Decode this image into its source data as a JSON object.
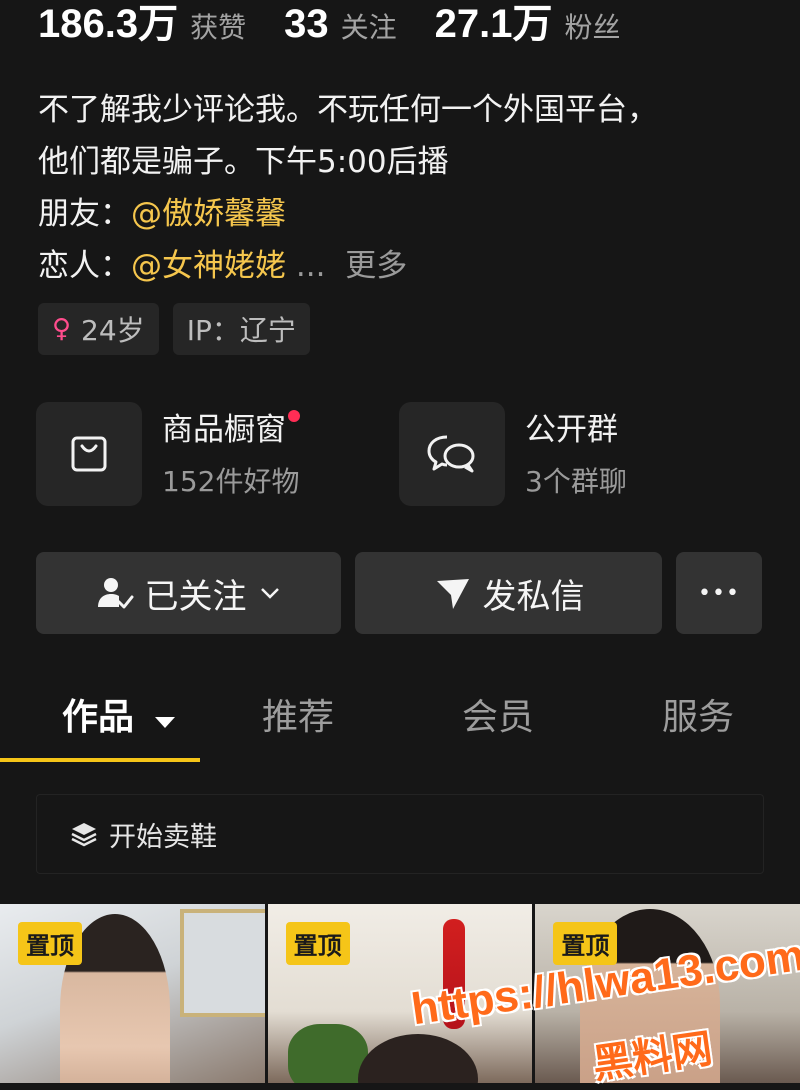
{
  "stats": [
    {
      "value": "186.3万",
      "label": "获赞"
    },
    {
      "value": "33",
      "label": "关注"
    },
    {
      "value": "27.1万",
      "label": "粉丝"
    }
  ],
  "bio": {
    "line1": "不了解我少评论我。不玩任何一个外国平台，",
    "line2": "他们都是骗子。下午5:00后播",
    "friend_label": "朋友：",
    "friend_mention": "@傲娇馨馨",
    "lover_label": "恋人：",
    "lover_mention": "@女神姥姥",
    "ellipsis": "...",
    "more": "更多"
  },
  "tags": {
    "gender_symbol": "♀",
    "age": "24岁",
    "ip": "IP：辽宁"
  },
  "cards": [
    {
      "title": "商品橱窗",
      "sub": "152件好物",
      "icon": "shopping-bag-icon",
      "has_dot": true
    },
    {
      "title": "公开群",
      "sub": "3个群聊",
      "icon": "chat-bubbles-icon",
      "has_dot": false
    }
  ],
  "actions": {
    "follow": "已关注",
    "message": "发私信",
    "more": "•••"
  },
  "tabs": [
    {
      "label": "作品",
      "active": true,
      "dropdown": true
    },
    {
      "label": "推荐",
      "active": false
    },
    {
      "label": "会员",
      "active": false
    },
    {
      "label": "服务",
      "active": false
    }
  ],
  "collection": {
    "label": "开始卖鞋"
  },
  "thumbnails": [
    {
      "badge": "置顶"
    },
    {
      "badge": "置顶"
    },
    {
      "badge": "置顶"
    }
  ],
  "watermark": {
    "url": "https://hlwa13.com",
    "name": "黑料网"
  },
  "colors": {
    "background": "#161616",
    "accent": "#f5c518",
    "mention": "#f5c64d",
    "dot": "#ff2d55"
  }
}
